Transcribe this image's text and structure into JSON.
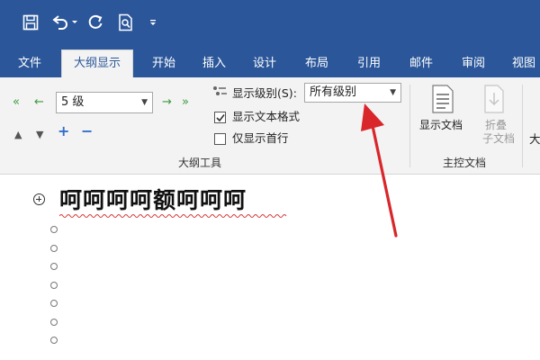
{
  "quick_access": {
    "icons": [
      "save-icon",
      "undo-icon",
      "dropdown-caret-icon",
      "redo-icon",
      "print-preview-icon",
      "customize-icon"
    ]
  },
  "tabs": [
    {
      "label": "文件"
    },
    {
      "label": "大纲显示",
      "active": true
    },
    {
      "label": "开始"
    },
    {
      "label": "插入"
    },
    {
      "label": "设计"
    },
    {
      "label": "布局"
    },
    {
      "label": "引用"
    },
    {
      "label": "邮件"
    },
    {
      "label": "审阅"
    },
    {
      "label": "视图"
    }
  ],
  "outline_tools": {
    "level_select": "5 级",
    "show_level_label": "显示级别(S):",
    "show_level_value": "所有级别",
    "show_text_format_label": "显示文本格式",
    "show_text_format_checked": true,
    "show_first_line_label": "仅显示首行",
    "show_first_line_checked": false,
    "group_title": "大纲工具"
  },
  "master_document": {
    "show_document_label": "显示文档",
    "collapse_label_line1": "折叠",
    "collapse_label_line2": "子文档",
    "group_title": "主控文档",
    "cut_off_char": "大"
  },
  "document": {
    "heading": "呵呵呵呵额呵呵呵",
    "empty_bullet_count": 7
  },
  "colors": {
    "ribbon_blue": "#2b579a",
    "annotation_red": "#d9262b"
  }
}
